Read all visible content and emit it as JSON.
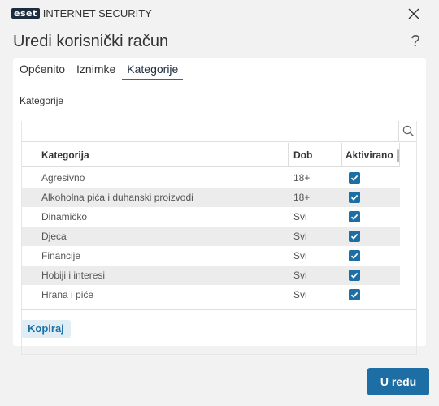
{
  "window": {
    "logo_mark": "eset",
    "logo_text": "INTERNET SECURITY"
  },
  "dialog": {
    "title": "Uredi korisnički račun",
    "help": "?"
  },
  "tabs": [
    {
      "label": "Općenito",
      "active": false
    },
    {
      "label": "Iznimke",
      "active": false
    },
    {
      "label": "Kategorije",
      "active": true
    }
  ],
  "section": {
    "label": "Kategorije"
  },
  "search": {
    "value": "",
    "placeholder": ""
  },
  "table": {
    "columns": [
      "Kategorija",
      "Dob",
      "Aktivirano"
    ],
    "rows": [
      {
        "category": "Agresivno",
        "age": "18+",
        "active": true
      },
      {
        "category": "Alkoholna pića i duhanski proizvodi",
        "age": "18+",
        "active": true
      },
      {
        "category": "Dinamičko",
        "age": "Svi",
        "active": true
      },
      {
        "category": "Djeca",
        "age": "Svi",
        "active": true
      },
      {
        "category": "Financije",
        "age": "Svi",
        "active": true
      },
      {
        "category": "Hobiji i interesi",
        "age": "Svi",
        "active": true
      },
      {
        "category": "Hrana i piće",
        "age": "Svi",
        "active": true
      }
    ]
  },
  "buttons": {
    "copy": "Kopiraj",
    "ok": "U redu"
  },
  "colors": {
    "accent": "#1c6ea4",
    "logo_bg": "#1d2d3f"
  }
}
